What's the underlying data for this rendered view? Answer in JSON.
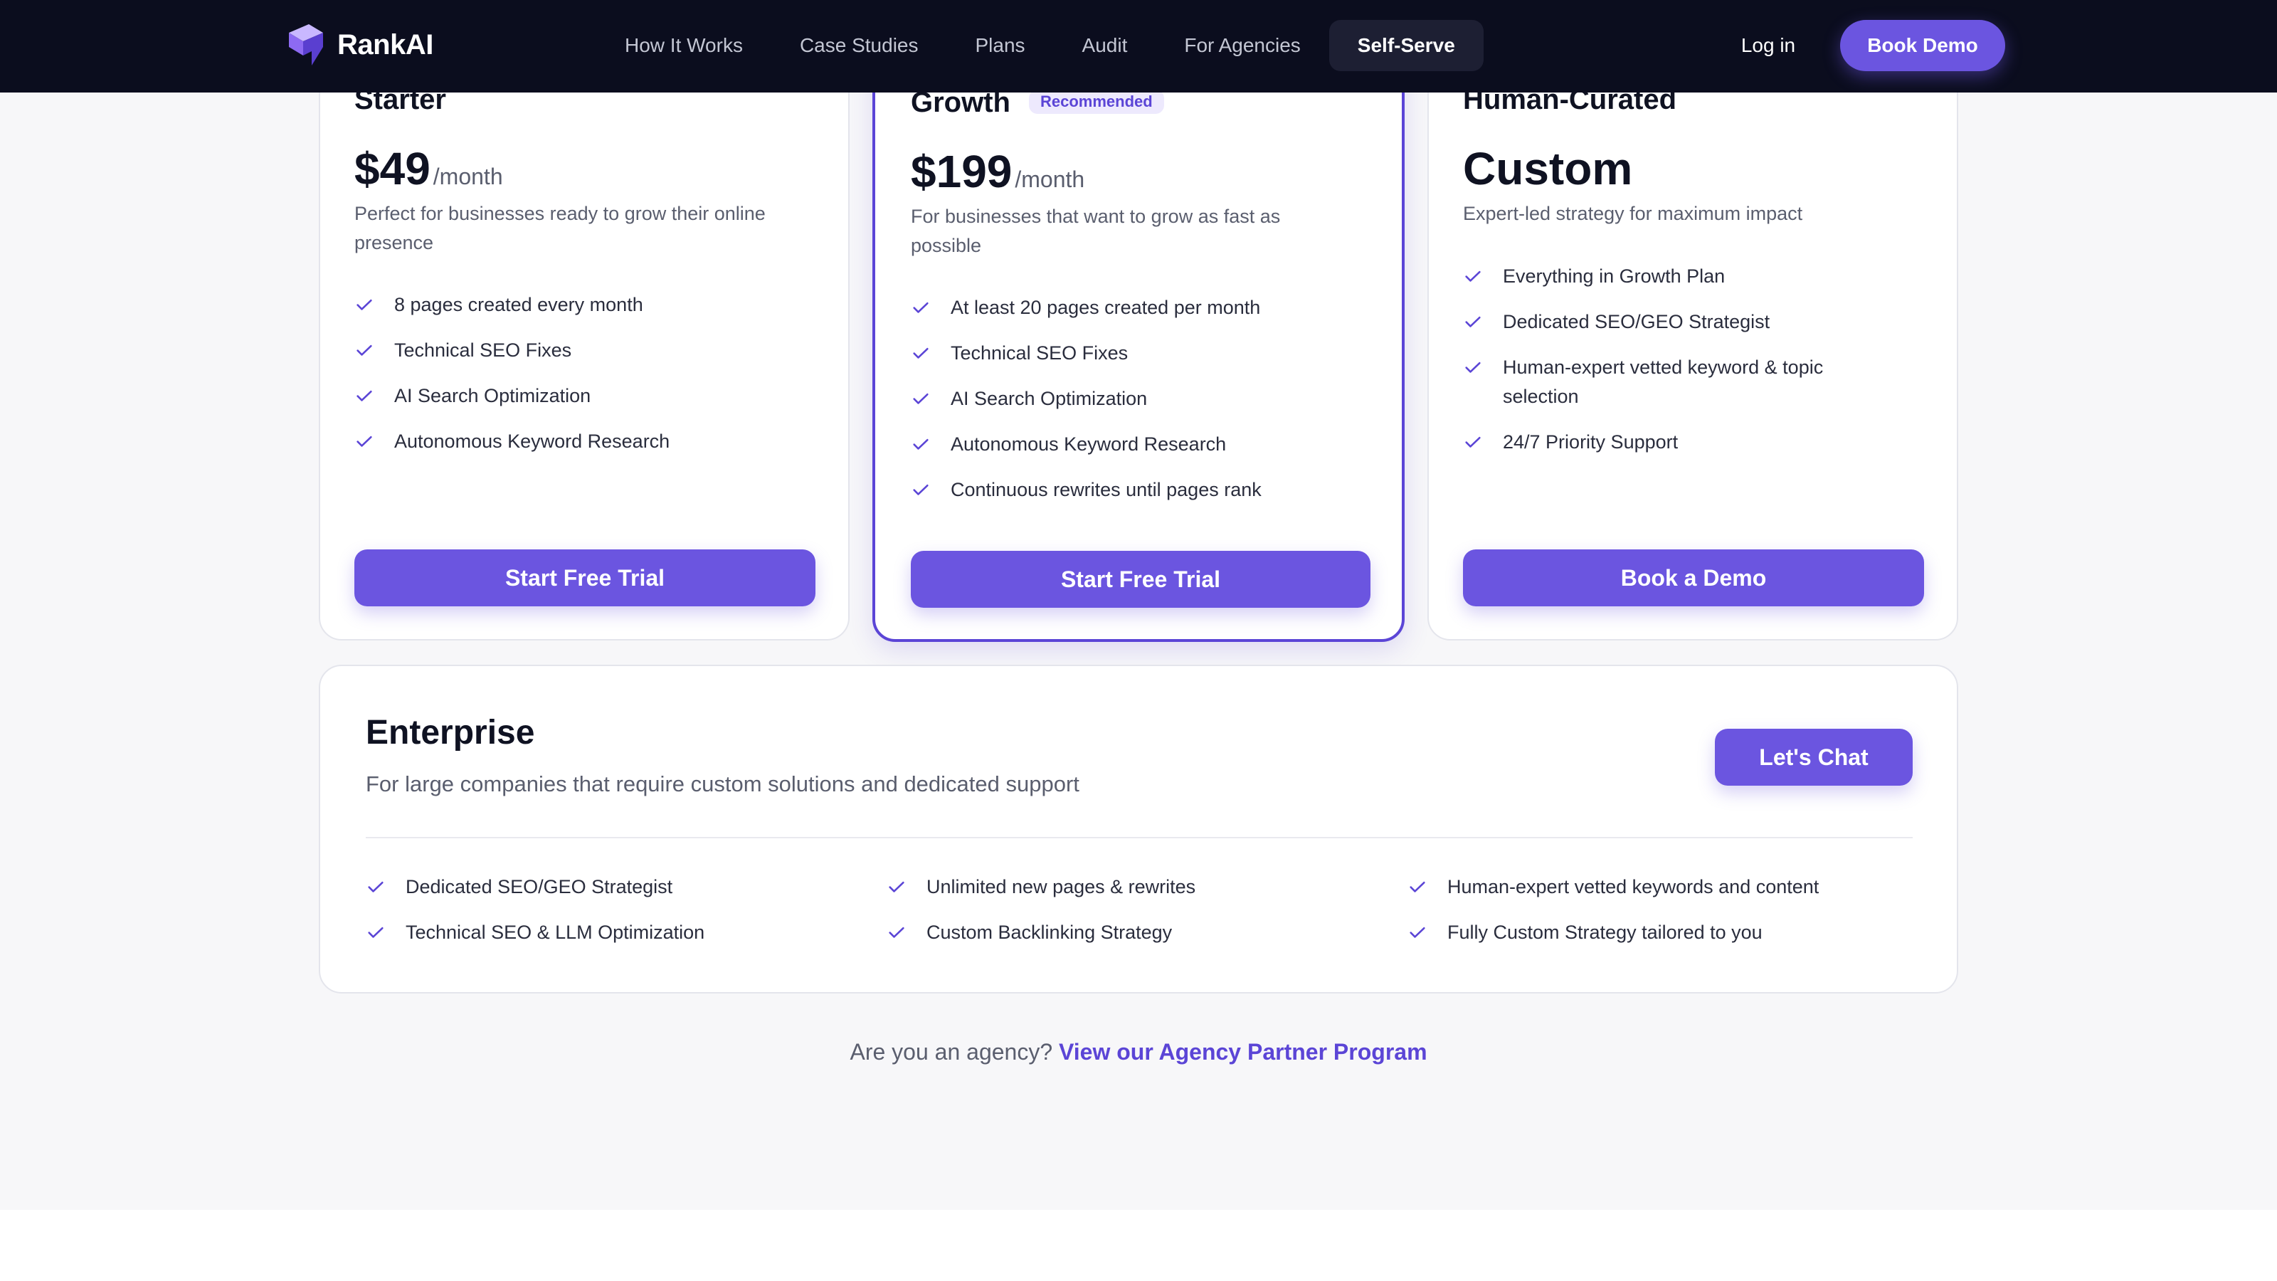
{
  "nav": {
    "logo_text": "RankAI",
    "links": [
      "How It Works",
      "Case Studies",
      "Plans",
      "Audit",
      "For Agencies",
      "Self-Serve"
    ],
    "active": "Self-Serve",
    "login": "Log in",
    "cta": "Book Demo"
  },
  "plans": [
    {
      "name": "Starter",
      "price": "$49",
      "unit": "/month",
      "description": "Perfect for businesses ready to grow their online presence",
      "features": [
        "8 pages created every month",
        "Technical SEO Fixes",
        "AI Search Optimization",
        "Autonomous Keyword Research"
      ],
      "cta": "Start Free Trial"
    },
    {
      "name": "Growth",
      "badge": "Recommended",
      "price": "$199",
      "unit": "/month",
      "description": "For businesses that want to grow as fast as possible",
      "features": [
        "At least 20 pages created per month",
        "Technical SEO Fixes",
        "AI Search Optimization",
        "Autonomous Keyword Research",
        "Continuous rewrites until pages rank"
      ],
      "cta": "Start Free Trial"
    },
    {
      "name": "Human-Curated",
      "price": "Custom",
      "description": "Expert-led strategy for maximum impact",
      "features": [
        "Everything in Growth Plan",
        "Dedicated SEO/GEO Strategist",
        "Human-expert vetted keyword & topic selection",
        "24/7 Priority Support"
      ],
      "cta": "Book a Demo"
    }
  ],
  "enterprise": {
    "title": "Enterprise",
    "description": "For large companies that require custom solutions and dedicated support",
    "cta": "Let's Chat",
    "features": [
      [
        "Dedicated SEO/GEO Strategist",
        "Technical SEO & LLM Optimization"
      ],
      [
        "Unlimited new pages & rewrites",
        "Custom Backlinking Strategy"
      ],
      [
        "Human-expert vetted keywords and content",
        "Fully Custom Strategy tailored to you"
      ]
    ]
  },
  "agency": {
    "question": "Are you an agency?",
    "link": "View our Agency Partner Program"
  },
  "colors": {
    "accent": "#6b55e0",
    "nav_bg": "#0b0d1e",
    "page_bg": "#f7f7f9"
  }
}
